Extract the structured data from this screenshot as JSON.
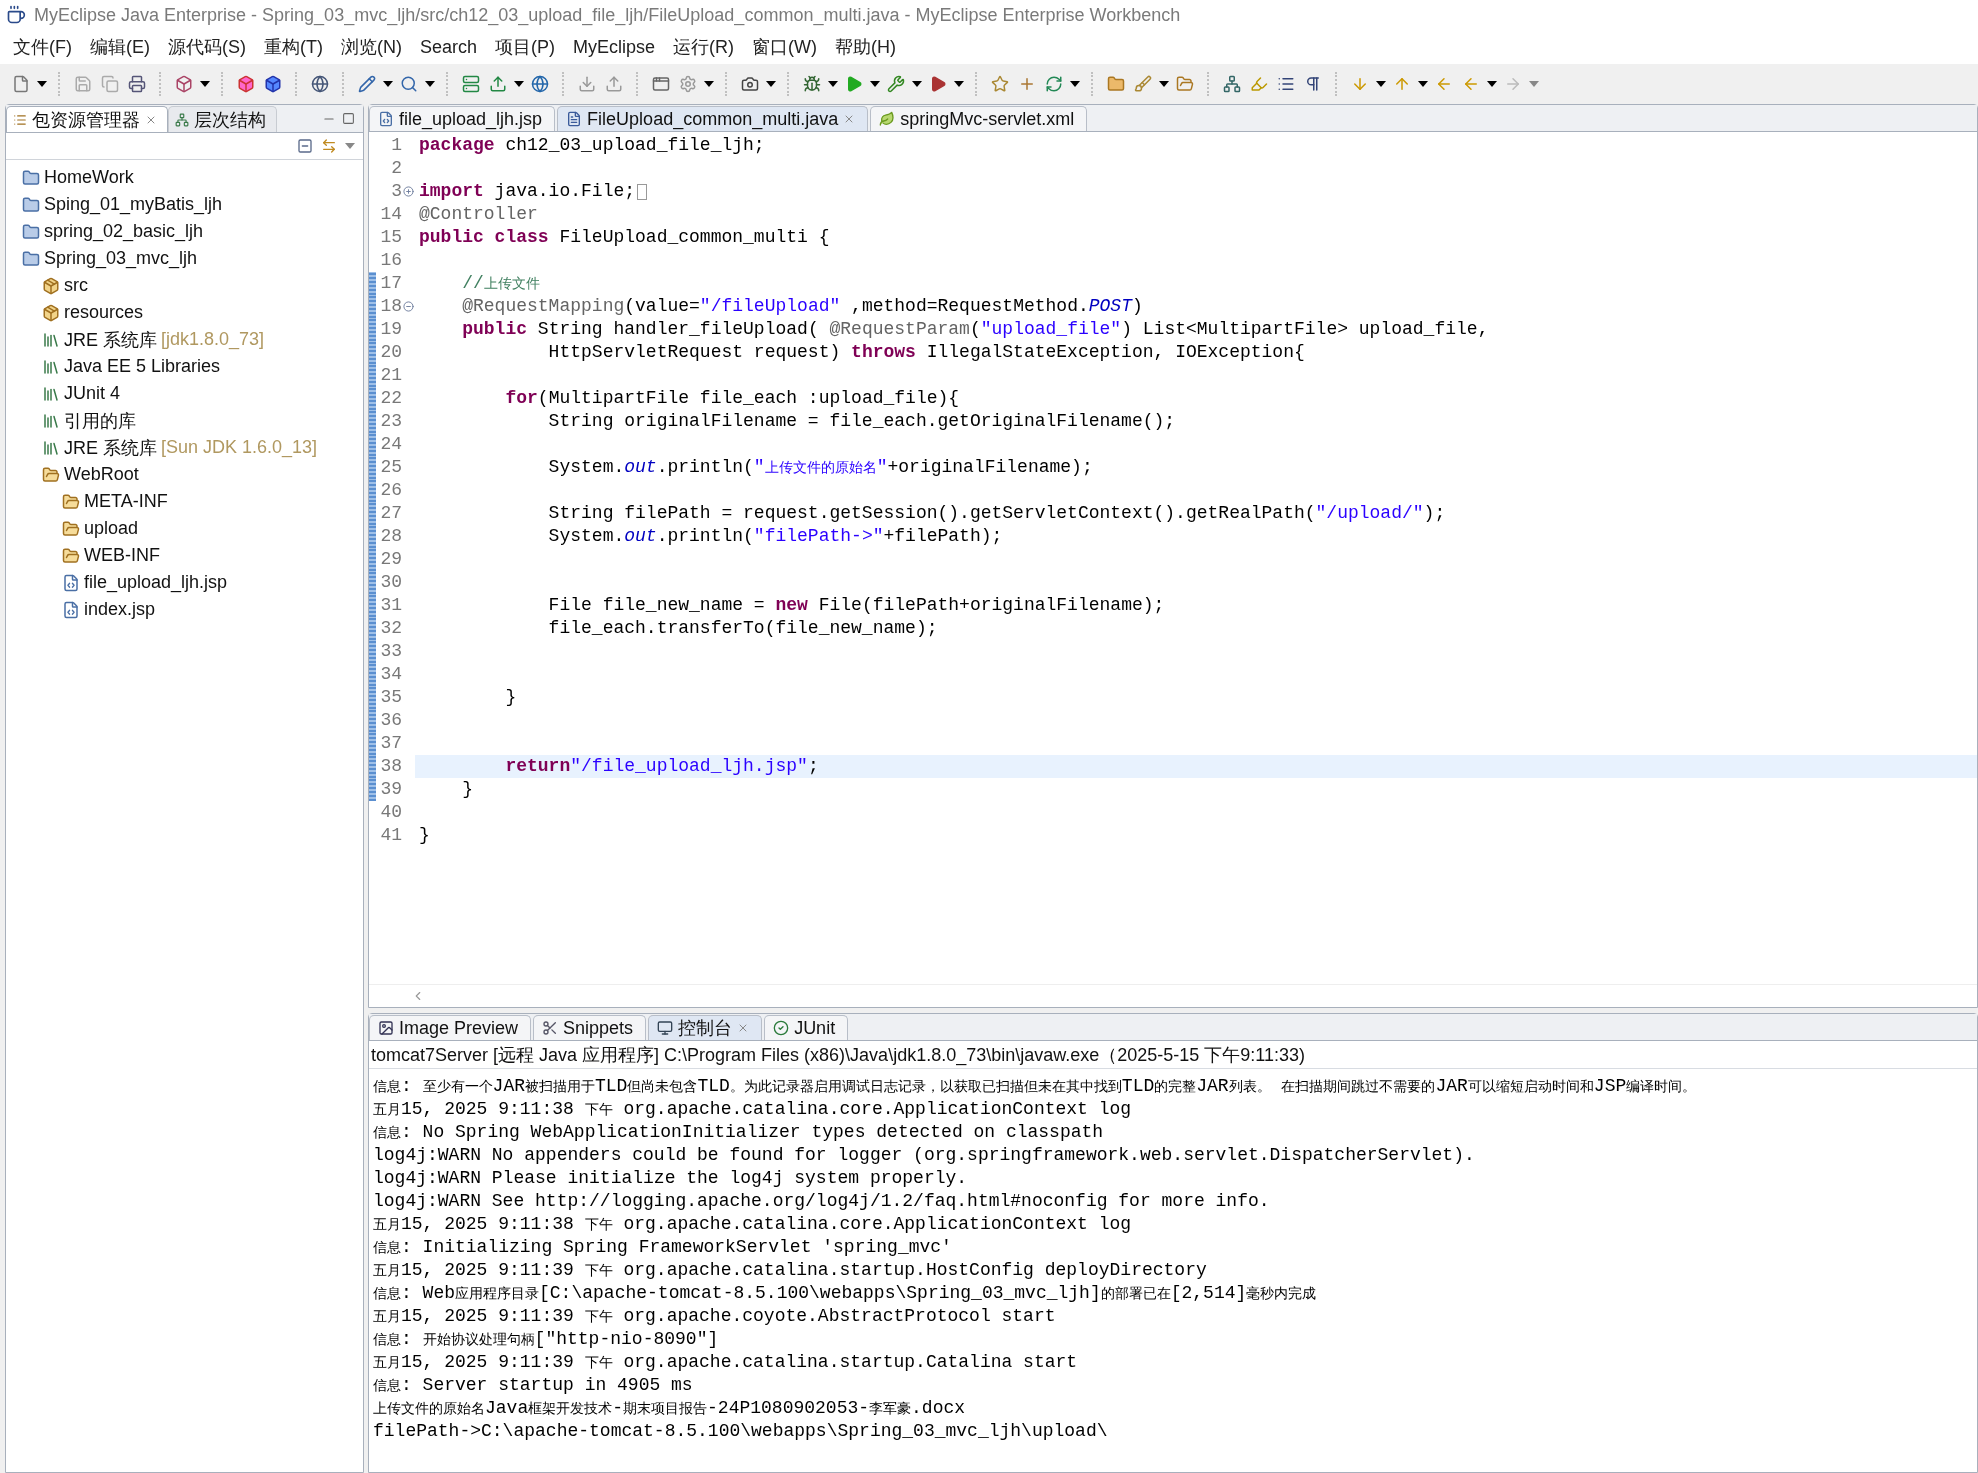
{
  "window": {
    "title": "MyEclipse Java Enterprise  -  Spring_03_mvc_ljh/src/ch12_03_upload_file_ljh/FileUpload_common_multi.java  -  MyEclipse Enterprise Workbench"
  },
  "menu": [
    "文件(F)",
    "编辑(E)",
    "源代码(S)",
    "重构(T)",
    "浏览(N)",
    "Search",
    "项目(P)",
    "MyEclipse",
    "运行(R)",
    "窗口(W)",
    "帮助(H)"
  ],
  "explorer": {
    "tabs": [
      {
        "label": "包资源管理器",
        "selected": true
      },
      {
        "label": "层次结构",
        "selected": false
      }
    ],
    "tree": [
      {
        "kind": "project",
        "label": "HomeWork"
      },
      {
        "kind": "project",
        "label": "Sping_01_myBatis_ljh"
      },
      {
        "kind": "project",
        "label": "spring_02_basic_ljh"
      },
      {
        "kind": "project",
        "label": "Spring_03_mvc_ljh",
        "children": [
          {
            "kind": "source",
            "label": "src"
          },
          {
            "kind": "source",
            "label": "resources"
          },
          {
            "kind": "library",
            "label": "JRE 系统库",
            "detail": "[jdk1.8.0_73]"
          },
          {
            "kind": "library",
            "label": "Java EE 5 Libraries"
          },
          {
            "kind": "library",
            "label": "JUnit 4"
          },
          {
            "kind": "library",
            "label": "引用的库"
          },
          {
            "kind": "library",
            "label": "JRE 系统库",
            "detail": "[Sun JDK 1.6.0_13]"
          },
          {
            "kind": "folder",
            "label": "WebRoot",
            "children": [
              {
                "kind": "folder",
                "label": "META-INF"
              },
              {
                "kind": "folder",
                "label": "upload"
              },
              {
                "kind": "folder",
                "label": "WEB-INF"
              },
              {
                "kind": "jsp",
                "label": "file_upload_ljh.jsp"
              },
              {
                "kind": "jsp",
                "label": "index.jsp"
              }
            ]
          }
        ]
      }
    ]
  },
  "editor": {
    "tabs": [
      {
        "label": "file_upload_ljh.jsp",
        "kind": "jsp",
        "selected": false
      },
      {
        "label": "FileUpload_common_multi.java",
        "kind": "java",
        "selected": true
      },
      {
        "label": "springMvc-servlet.xml",
        "kind": "xml",
        "selected": false
      }
    ],
    "lines": [
      {
        "n": "1",
        "current": false,
        "in_range": false,
        "code": [
          {
            "kind": "keyword",
            "text": "package"
          },
          {
            "kind": "plain",
            "text": " ch12_03_upload_file_ljh;"
          }
        ]
      },
      {
        "n": "2",
        "current": false,
        "in_range": false
      },
      {
        "n": "3",
        "current": false,
        "in_range": false,
        "expanded": false,
        "code": [
          {
            "kind": "keyword",
            "text": "import"
          },
          {
            "kind": "plain",
            "text": " java.io.File;"
          }
        ]
      },
      {
        "n": "14",
        "current": false,
        "in_range": false,
        "code": [
          {
            "kind": "annotation",
            "text": "@Controller"
          }
        ]
      },
      {
        "n": "15",
        "current": false,
        "in_range": false,
        "code": [
          {
            "kind": "keyword",
            "text": "public class"
          },
          {
            "kind": "plain",
            "text": " FileUpload_common_multi {"
          }
        ]
      },
      {
        "n": "16",
        "current": false,
        "in_range": false
      },
      {
        "n": "17",
        "current": false,
        "in_range": true,
        "code": [
          {
            "kind": "comment",
            "text": "    //上传文件"
          }
        ]
      },
      {
        "n": "18",
        "current": false,
        "in_range": true,
        "expanded": true,
        "code": [
          {
            "kind": "annotation",
            "text": "    @RequestMapping"
          },
          {
            "kind": "plain",
            "text": "(value="
          },
          {
            "kind": "string",
            "text": "\"/fileUpload\""
          },
          {
            "kind": "plain",
            "text": " ,method=RequestMethod."
          },
          {
            "kind": "field",
            "text": "POST"
          },
          {
            "kind": "plain",
            "text": ")"
          }
        ]
      },
      {
        "n": "19",
        "current": false,
        "in_range": true,
        "code": [
          {
            "kind": "keyword",
            "text": "    public"
          },
          {
            "kind": "plain",
            "text": " String handler_fileUpload( "
          },
          {
            "kind": "annotation",
            "text": "@RequestParam"
          },
          {
            "kind": "plain",
            "text": "("
          },
          {
            "kind": "string",
            "text": "\"upload_file\""
          },
          {
            "kind": "plain",
            "text": ") List<MultipartFile> upload_file,"
          }
        ]
      },
      {
        "n": "20",
        "current": false,
        "in_range": true,
        "code": [
          {
            "kind": "plain",
            "text": "            HttpServletRequest request) "
          },
          {
            "kind": "keyword",
            "text": "throws"
          },
          {
            "kind": "plain",
            "text": " IllegalStateException, IOException{"
          }
        ]
      },
      {
        "n": "21",
        "current": false,
        "in_range": true
      },
      {
        "n": "22",
        "current": false,
        "in_range": true,
        "code": [
          {
            "kind": "keyword",
            "text": "        for"
          },
          {
            "kind": "plain",
            "text": "(MultipartFile file_each :upload_file){"
          }
        ]
      },
      {
        "n": "23",
        "current": false,
        "in_range": true,
        "code": [
          {
            "kind": "plain",
            "text": "            String originalFilename = file_each.getOriginalFilename();"
          }
        ]
      },
      {
        "n": "24",
        "current": false,
        "in_range": true
      },
      {
        "n": "25",
        "current": false,
        "in_range": true,
        "code": [
          {
            "kind": "plain",
            "text": "            System."
          },
          {
            "kind": "field",
            "text": "out"
          },
          {
            "kind": "plain",
            "text": ".println("
          },
          {
            "kind": "string",
            "text": "\"上传文件的原始名\""
          },
          {
            "kind": "plain",
            "text": "+originalFilename);"
          }
        ]
      },
      {
        "n": "26",
        "current": false,
        "in_range": true
      },
      {
        "n": "27",
        "current": false,
        "in_range": true,
        "code": [
          {
            "kind": "plain",
            "text": "            String filePath = request.getSession().getServletContext().getRealPath("
          },
          {
            "kind": "string",
            "text": "\"/upload/\""
          },
          {
            "kind": "plain",
            "text": ");"
          }
        ]
      },
      {
        "n": "28",
        "current": false,
        "in_range": true,
        "code": [
          {
            "kind": "plain",
            "text": "            System."
          },
          {
            "kind": "field",
            "text": "out"
          },
          {
            "kind": "plain",
            "text": ".println("
          },
          {
            "kind": "string",
            "text": "\"filePath->\""
          },
          {
            "kind": "plain",
            "text": "+filePath);"
          }
        ]
      },
      {
        "n": "29",
        "current": false,
        "in_range": true
      },
      {
        "n": "30",
        "current": false,
        "in_range": true
      },
      {
        "n": "31",
        "current": false,
        "in_range": true,
        "code": [
          {
            "kind": "plain",
            "text": "            File file_new_name = "
          },
          {
            "kind": "keyword",
            "text": "new"
          },
          {
            "kind": "plain",
            "text": " File(filePath+originalFilename);"
          }
        ]
      },
      {
        "n": "32",
        "current": false,
        "in_range": true,
        "code": [
          {
            "kind": "plain",
            "text": "            file_each.transferTo(file_new_name);"
          }
        ]
      },
      {
        "n": "33",
        "current": false,
        "in_range": true
      },
      {
        "n": "34",
        "current": false,
        "in_range": true
      },
      {
        "n": "35",
        "current": false,
        "in_range": true,
        "code": [
          {
            "kind": "plain",
            "text": "        }"
          }
        ]
      },
      {
        "n": "36",
        "current": false,
        "in_range": true
      },
      {
        "n": "37",
        "current": false,
        "in_range": true
      },
      {
        "n": "38",
        "current": true,
        "in_range": true,
        "code": [
          {
            "kind": "keyword",
            "text": "        return"
          },
          {
            "kind": "string",
            "text": "\"/file_upload_ljh.jsp\""
          },
          {
            "kind": "plain",
            "text": ";"
          }
        ]
      },
      {
        "n": "39",
        "current": false,
        "in_range": true,
        "code": [
          {
            "kind": "plain",
            "text": "    }"
          }
        ]
      },
      {
        "n": "40",
        "current": false,
        "in_range": false
      },
      {
        "n": "41",
        "current": false,
        "in_range": false,
        "code": [
          {
            "kind": "plain",
            "text": "}"
          }
        ]
      }
    ]
  },
  "console": {
    "tabs": [
      {
        "label": "Image Preview",
        "kind": "image",
        "selected": false
      },
      {
        "label": "Snippets",
        "kind": "snippets",
        "selected": false
      },
      {
        "label": "控制台",
        "kind": "console",
        "selected": true
      },
      {
        "label": "JUnit",
        "kind": "junit",
        "selected": false
      }
    ],
    "process": "tomcat7Server [远程 Java 应用程序] C:\\Program Files (x86)\\Java\\jdk1.8.0_73\\bin\\javaw.exe（2025-5-15 下午9:11:33)",
    "lines": [
      "信息: 至少有一个JAR被扫描用于TLD但尚未包含TLD。为此记录器启用调试日志记录，以获取已扫描但未在其中找到TLD的完整JAR列表。 在扫描期间跳过不需要的JAR可以缩短启动时间和JSP编译时间。",
      "五月15, 2025 9:11:38 下午 org.apache.catalina.core.ApplicationContext log",
      "信息: No Spring WebApplicationInitializer types detected on classpath",
      "log4j:WARN No appenders could be found for logger (org.springframework.web.servlet.DispatcherServlet).",
      "log4j:WARN Please initialize the log4j system properly.",
      "log4j:WARN See http://logging.apache.org/log4j/1.2/faq.html#noconfig for more info.",
      "五月15, 2025 9:11:38 下午 org.apache.catalina.core.ApplicationContext log",
      "信息: Initializing Spring FrameworkServlet 'spring_mvc'",
      "五月15, 2025 9:11:39 下午 org.apache.catalina.startup.HostConfig deployDirectory",
      "信息: Web应用程序目录[C:\\apache-tomcat-8.5.100\\webapps\\Spring_03_mvc_ljh]的部署已在[2,514]毫秒内完成",
      "五月15, 2025 9:11:39 下午 org.apache.coyote.AbstractProtocol start",
      "信息: 开始协议处理句柄[\"http-nio-8090\"]",
      "五月15, 2025 9:11:39 下午 org.apache.catalina.startup.Catalina start",
      "信息: Server startup in 4905 ms",
      "上传文件的原始名Java框架开发技术-期末项目报告-24P1080902053-李军豪.docx",
      "filePath->C:\\apache-tomcat-8.5.100\\webapps\\Spring_03_mvc_ljh\\upload\\"
    ]
  }
}
